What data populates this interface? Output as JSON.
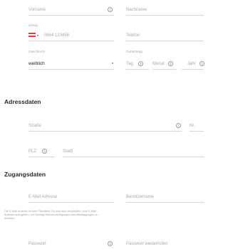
{
  "personal": {
    "vorname_placeholder": "Vorname",
    "nachname_placeholder": "Nachname",
    "handy_label": "Handy",
    "phone_placeholder": "0664 123456",
    "telefon_placeholder": "Telefon",
    "geschlecht_label": "Geschlecht",
    "geschlecht_value": "weiblich",
    "geburtstag_label": "Geburtstag",
    "tag_placeholder": "Tag",
    "monat_placeholder": "Monat",
    "jahr_placeholder": "Jahr"
  },
  "address": {
    "title": "Adressdaten",
    "strasse_placeholder": "Straße",
    "nr_placeholder": "Nr.",
    "plz_placeholder": "PLZ",
    "stadt_placeholder": "Stadt"
  },
  "access": {
    "title": "Zugangsdaten",
    "email_placeholder": "E-Mail Adresse",
    "username_placeholder": "Benutzername",
    "hint_text": "Die E-Mail Adresse ist kein Pflichtfeld. Es wird aber empfohlen, eine E-Mail Adresse anzugeben, um wichtige Benachrichtigungen und Bestätigungen zu erhalten.",
    "passwort_placeholder": "Passwort",
    "passwort_repeat_placeholder": "Passwort wiederholen"
  },
  "icons": {
    "info_glyph": "i",
    "caret_glyph": "▾"
  },
  "colors": {
    "flag_red": "#e53935"
  }
}
